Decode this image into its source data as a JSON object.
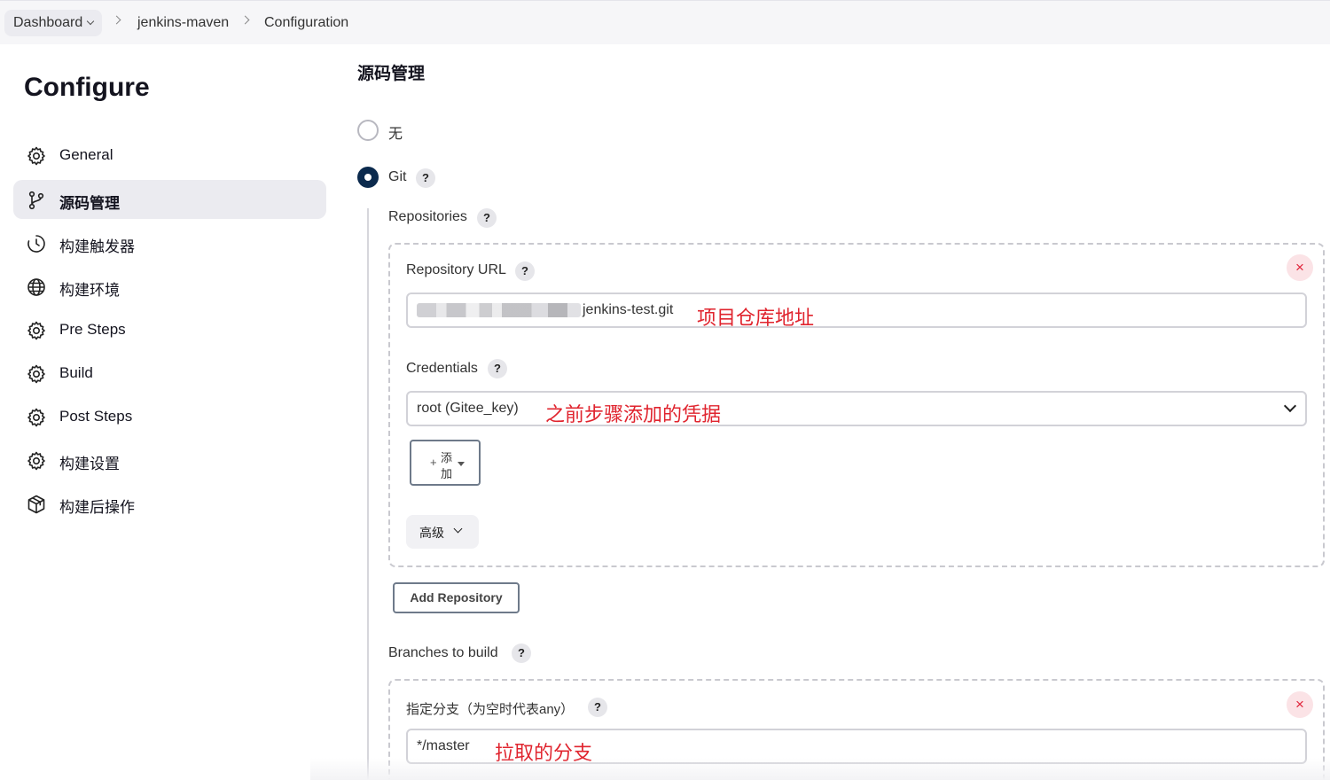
{
  "breadcrumb": {
    "dashboard": "Dashboard",
    "project": "jenkins-maven",
    "page": "Configuration"
  },
  "sidebar": {
    "title": "Configure",
    "items": [
      {
        "label": "General",
        "icon": "gear-icon"
      },
      {
        "label": "源码管理",
        "icon": "branch-icon",
        "active": true
      },
      {
        "label": "构建触发器",
        "icon": "clock-icon"
      },
      {
        "label": "构建环境",
        "icon": "globe-icon"
      },
      {
        "label": "Pre Steps",
        "icon": "gear-icon"
      },
      {
        "label": "Build",
        "icon": "gear-icon"
      },
      {
        "label": "Post Steps",
        "icon": "gear-icon"
      },
      {
        "label": "构建设置",
        "icon": "gear-icon"
      },
      {
        "label": "构建后操作",
        "icon": "package-icon"
      }
    ]
  },
  "scm": {
    "title": "源码管理",
    "option_none": "无",
    "option_git": "Git",
    "selected": "Git",
    "help": "?",
    "repositories_label": "Repositories",
    "repo_url_label": "Repository URL",
    "repo_url_value": "jenkins-test.git",
    "repo_url_note": "项目仓库地址",
    "credentials_label": "Credentials",
    "credentials_value": "root (Gitee_key)",
    "credentials_note": "之前步骤添加的凭据",
    "add_plus": "+",
    "add_line1": "添",
    "add_line2": "加",
    "advanced_label": "高级",
    "close_symbol": "×",
    "add_repository": "Add Repository",
    "branches_label": "Branches to build",
    "branch_spec_label": "指定分支（为空时代表any）",
    "branch_value": "*/master",
    "branch_note": "拉取的分支"
  },
  "colors": {
    "accent": "#0b2a4d",
    "annotation": "#e0242e",
    "delete": "#e0243a"
  }
}
